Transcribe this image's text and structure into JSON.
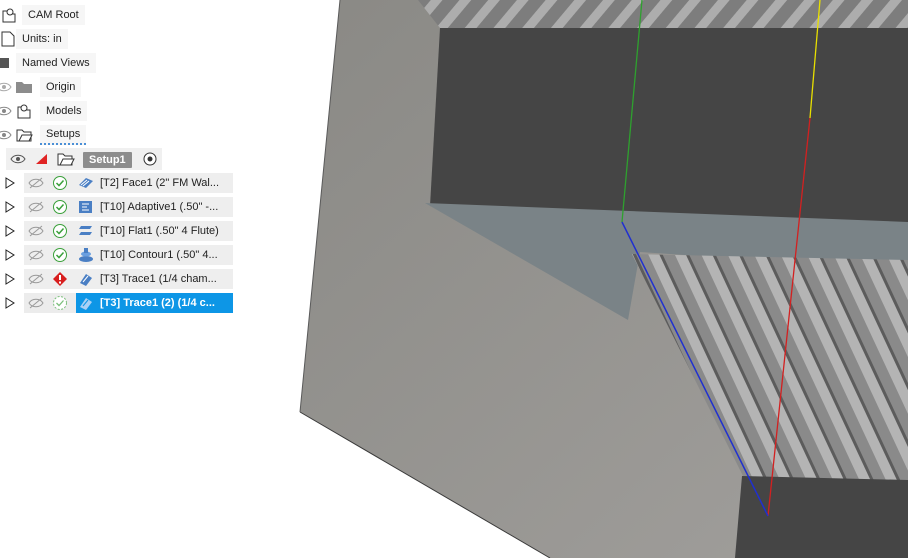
{
  "browser": {
    "root_label": "CAM Root",
    "units_label": "Units: in",
    "named_views_label": "Named Views",
    "origin_label": "Origin",
    "models_label": "Models",
    "setups_label": "Setups",
    "setup": {
      "label": "Setup1"
    },
    "operations": [
      {
        "label": "[T2] Face1 (2\" FM Wal...",
        "status": "ok",
        "icon": "face-op-icon",
        "selected": false
      },
      {
        "label": "[T10] Adaptive1 (.50\" -...",
        "status": "ok",
        "icon": "adaptive-op-icon",
        "selected": false
      },
      {
        "label": "[T10] Flat1 (.50\" 4 Flute)",
        "status": "ok",
        "icon": "flat-op-icon",
        "selected": false
      },
      {
        "label": "[T10] Contour1 (.50\" 4...",
        "status": "ok",
        "icon": "contour-op-icon",
        "selected": false
      },
      {
        "label": "[T3] Trace1 (1/4 cham...",
        "status": "error",
        "icon": "trace-op-icon",
        "selected": false
      },
      {
        "label": "[T3] Trace1 (2) (1/4 c...",
        "status": "pending",
        "icon": "trace-op-icon",
        "selected": true
      }
    ]
  },
  "viewport": {
    "axis_colors": {
      "x": "#d32020",
      "y": "#2ea12e",
      "z": "#2030d0",
      "y_alt": "#e8e000"
    },
    "model_colors": {
      "outer_wall": "#939290",
      "dark_face": "#454545",
      "cut_face": "#7a8387",
      "threads": "#9a9a9a"
    }
  }
}
